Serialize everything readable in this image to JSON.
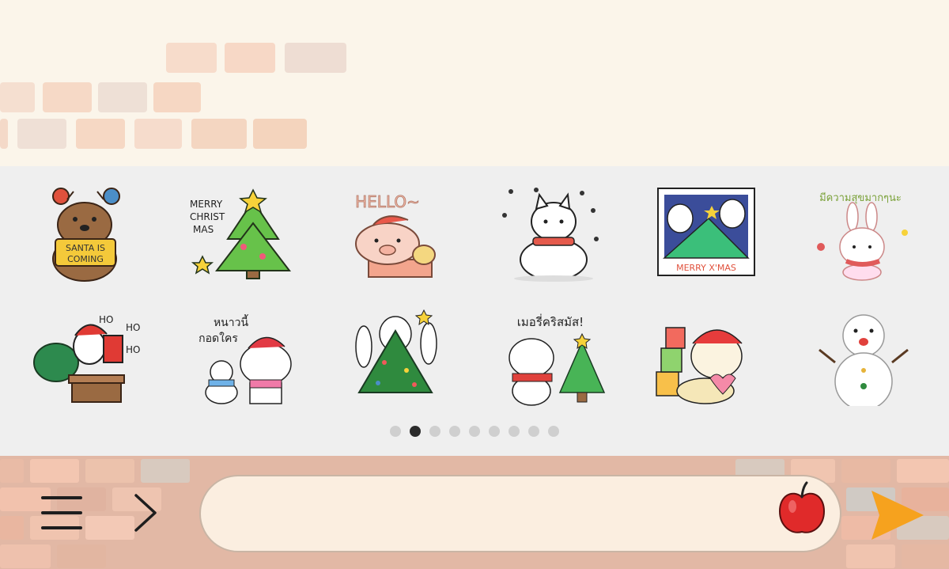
{
  "colors": {
    "accent_send": "#f6a21e",
    "page_bg": "#fbf5ea",
    "panel_bg": "#efefef",
    "brick_wall": "#e2b8a5",
    "dot_active": "#2b2b2b",
    "dot_inactive": "#cfcfcf"
  },
  "stickers": [
    {
      "name": "bear-reindeer-santa-sticker",
      "text": "SANTA IS COMING"
    },
    {
      "name": "christmas-tree-sticker",
      "text": "MERRY CHRIST MAS"
    },
    {
      "name": "pig-chimney-sticker",
      "text": "HELLO~"
    },
    {
      "name": "snow-cat-sticker",
      "text": ""
    },
    {
      "name": "penguins-frame-sticker",
      "text": "MERRY X'MAS"
    },
    {
      "name": "bunny-thai-sticker",
      "text": "มีความสุขมากๆนะ"
    },
    {
      "name": "santa-chimney-sticker",
      "text": "HO HO HO"
    },
    {
      "name": "cold-hug-sticker",
      "text": "หนาวนี้ กอดใคร"
    },
    {
      "name": "bird-tree-costume-sticker",
      "text": ""
    },
    {
      "name": "puppy-tree-thai-sticker",
      "text": "เมอรี่คริสมัส!"
    },
    {
      "name": "bear-gifts-sticker",
      "text": ""
    },
    {
      "name": "snowman-sticker",
      "text": ""
    }
  ],
  "pagination": {
    "total": 9,
    "active": 2
  },
  "composer": {
    "value": "",
    "placeholder": ""
  },
  "icons": {
    "menu": "hamburger-menu-icon",
    "expand": "chevron-right-icon",
    "sticker": "apple-sticker-icon",
    "send": "send-arrow-icon"
  }
}
